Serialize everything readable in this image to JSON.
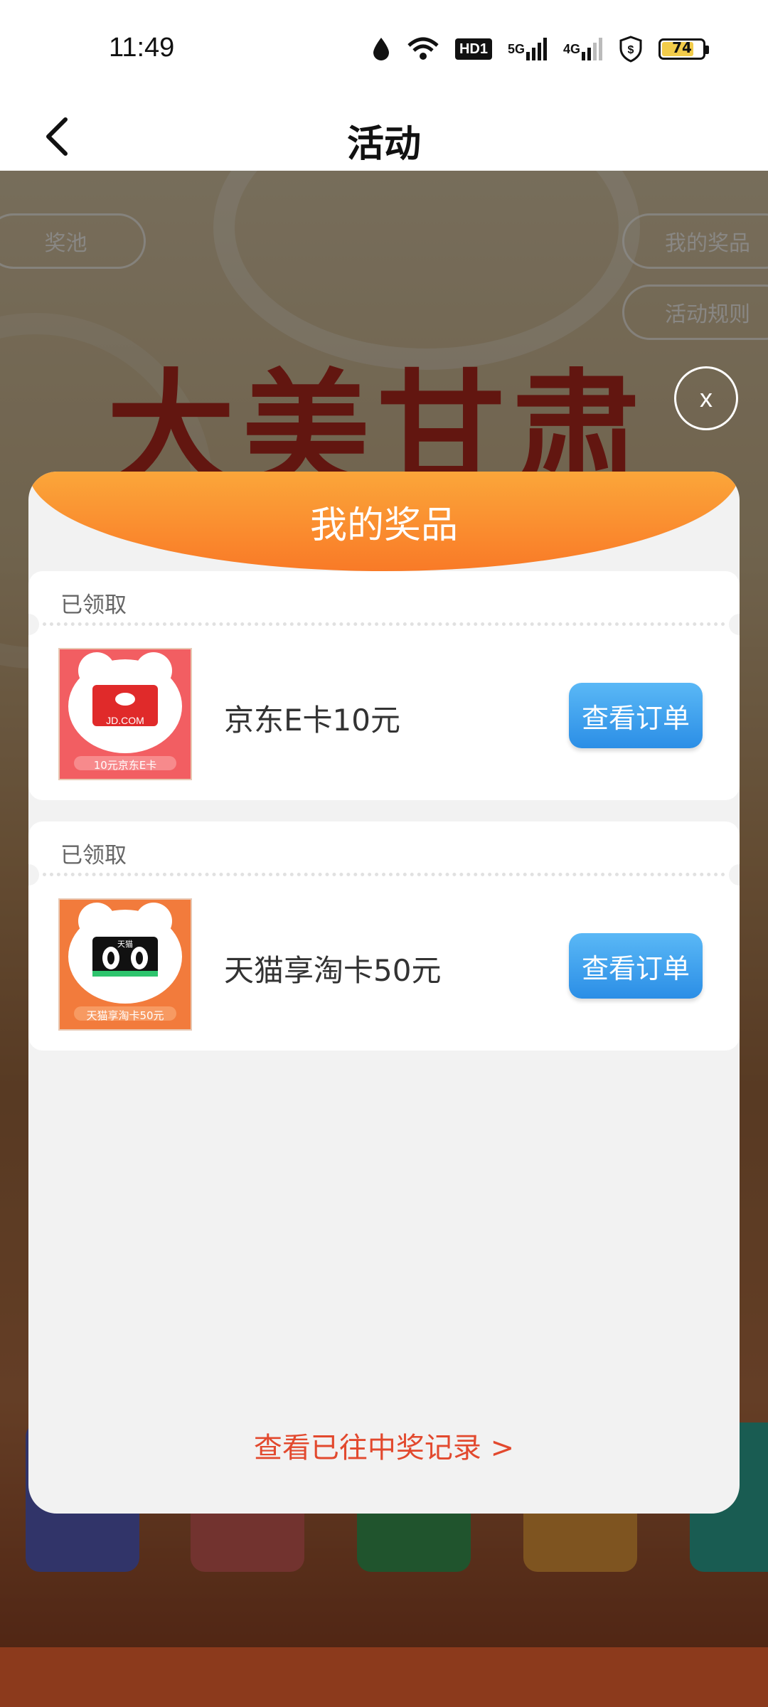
{
  "status_bar": {
    "time": "11:49",
    "battery": "74",
    "hd_label": "HD1",
    "net1": "5G",
    "net2": "4G"
  },
  "header": {
    "title": "活动"
  },
  "background": {
    "chip_pool": "奖池",
    "chip_my_prizes": "我的奖品",
    "chip_rules": "活动规则",
    "banner_title": "大美甘肃"
  },
  "modal": {
    "close_label": "x",
    "title": "我的奖品",
    "prizes": [
      {
        "status": "已领取",
        "name": "京东E卡10元",
        "button": "查看订单",
        "thumb_caption": "10元京东E卡",
        "thumb_brand": "JD.COM",
        "thumb_color": "#f25e62"
      },
      {
        "status": "已领取",
        "name": "天猫享淘卡50元",
        "button": "查看订单",
        "thumb_caption": "天猫享淘卡50元",
        "thumb_brand": "天猫",
        "thumb_color": "#f27b3c"
      }
    ],
    "history_link": "查看已往中奖记录 >"
  },
  "colors": {
    "accent_orange": "#f97a27",
    "button_blue": "#2b8ee6",
    "link_red": "#e2492e"
  }
}
